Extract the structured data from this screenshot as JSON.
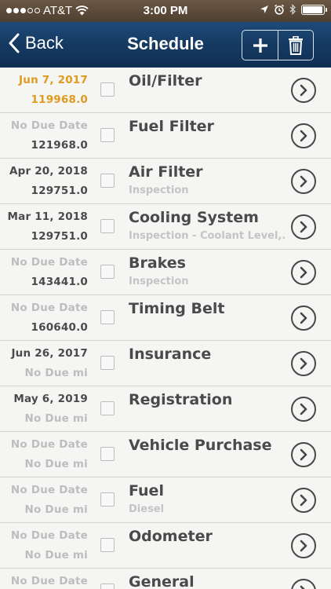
{
  "status_bar": {
    "carrier": "AT&T",
    "time": "3:00 PM",
    "signal_bars_filled": 3,
    "signal_bars_total": 5,
    "battery_level": 0.95
  },
  "nav": {
    "back_label": "Back",
    "title": "Schedule"
  },
  "colors": {
    "overdue": "#e09a1e",
    "nav_blue": "#1f4a78",
    "divider_pink": "#d9a8cf"
  },
  "items": [
    {
      "date": "Jun 7, 2017",
      "mileage": "119968.0",
      "name": "Oil/Filter",
      "subtitle": "",
      "date_style": "overdue",
      "mileage_style": "overdue"
    },
    {
      "date": "No Due Date",
      "mileage": "121968.0",
      "name": "Fuel Filter",
      "subtitle": "",
      "date_style": "dim",
      "mileage_style": ""
    },
    {
      "date": "Apr 20, 2018",
      "mileage": "129751.0",
      "name": "Air Filter",
      "subtitle": "Inspection",
      "date_style": "",
      "mileage_style": ""
    },
    {
      "date": "Mar 11, 2018",
      "mileage": "129751.0",
      "name": "Cooling System",
      "subtitle": "Inspection - Coolant Level,...",
      "date_style": "",
      "mileage_style": ""
    },
    {
      "date": "No Due Date",
      "mileage": "143441.0",
      "name": "Brakes",
      "subtitle": "Inspection",
      "date_style": "dim",
      "mileage_style": ""
    },
    {
      "date": "No Due Date",
      "mileage": "160640.0",
      "name": "Timing Belt",
      "subtitle": "",
      "date_style": "dim",
      "mileage_style": ""
    },
    {
      "date": "Jun 26, 2017",
      "mileage": "No Due mi",
      "name": "Insurance",
      "subtitle": "",
      "date_style": "",
      "mileage_style": "dim"
    },
    {
      "date": "May 6, 2019",
      "mileage": "No Due mi",
      "name": "Registration",
      "subtitle": "",
      "date_style": "",
      "mileage_style": "dim"
    },
    {
      "date": "No Due Date",
      "mileage": "No Due mi",
      "name": "Vehicle Purchase",
      "subtitle": "",
      "date_style": "dim",
      "mileage_style": "dim"
    },
    {
      "date": "No Due Date",
      "mileage": "No Due mi",
      "name": "Fuel",
      "subtitle": "Diesel",
      "date_style": "dim",
      "mileage_style": "dim"
    },
    {
      "date": "No Due Date",
      "mileage": "No Due mi",
      "name": "Odometer",
      "subtitle": "",
      "date_style": "dim",
      "mileage_style": "dim"
    },
    {
      "date": "No Due Date",
      "mileage": "",
      "name": "General",
      "subtitle": "",
      "date_style": "dim",
      "mileage_style": "dim"
    }
  ]
}
